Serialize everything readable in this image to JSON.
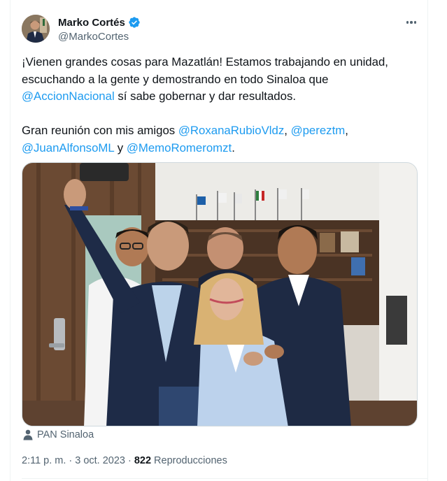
{
  "author": {
    "name": "Marko Cortés",
    "handle": "@MarkoCortes",
    "verified": true
  },
  "tweet": {
    "line1": "¡Vienen grandes cosas para Mazatlán! Estamos trabajando en unidad,",
    "line2": "escuchando a la gente y demostrando en todo Sinaloa que",
    "line3_mention": "@AccionNacional",
    "line3_rest": " sí sabe gobernar y dar resultados.",
    "line4_text": "Gran reunión con mis amigos ",
    "mention_1": "@RoxanaRubioVldz",
    "sep_1": ", ",
    "mention_2": "@pereztm",
    "sep_2": ",",
    "mention_3": "@JuanAlfonsoML",
    "sep_3": " y ",
    "mention_4": "@MemoRomeromzt",
    "end": "."
  },
  "media_tag": {
    "icon": "person-icon",
    "label": "PAN Sinaloa"
  },
  "meta": {
    "time": "2:11 p. m.",
    "dot": "·",
    "date": "3 oct. 2023",
    "dot2": "·",
    "views_count": "822",
    "views_label": "Reproducciones"
  },
  "colors": {
    "accent": "#1d9bf0",
    "text": "#0f1419",
    "secondary": "#536471"
  }
}
